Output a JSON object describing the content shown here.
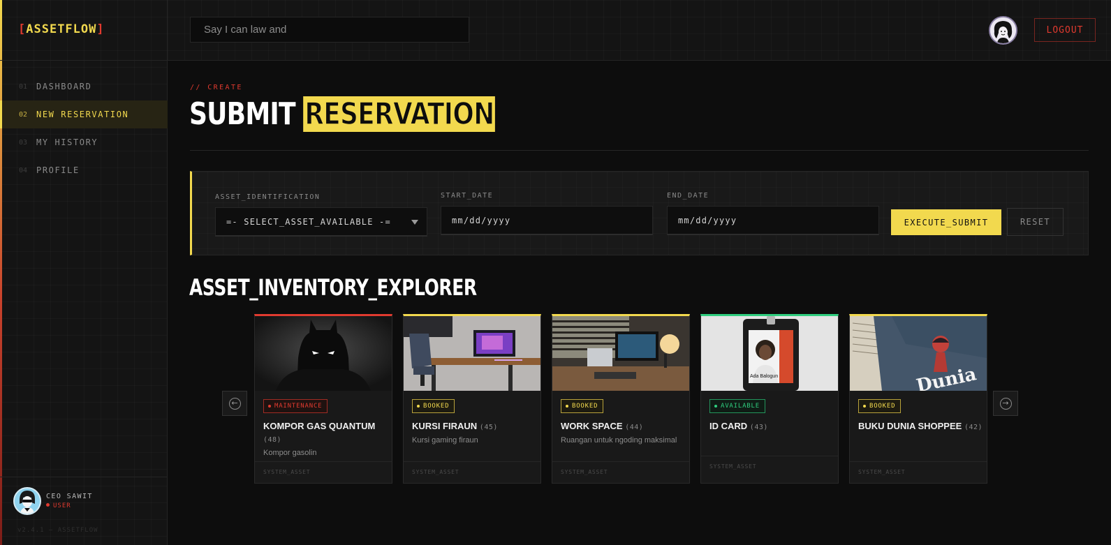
{
  "app": {
    "logo_open": "[",
    "logo_text": "ASSETFLOW",
    "logo_close": "]",
    "version": "v2.4.1 — ASSETFLOW"
  },
  "sidebar": {
    "items": [
      {
        "num": "01",
        "label": "DASHBOARD",
        "active": false
      },
      {
        "num": "02",
        "label": "NEW RESERVATION",
        "active": true
      },
      {
        "num": "03",
        "label": "MY HISTORY",
        "active": false
      },
      {
        "num": "04",
        "label": "PROFILE",
        "active": false
      }
    ],
    "user": {
      "name": "CEO SAWIT",
      "role": "USER"
    }
  },
  "topbar": {
    "search_value": "Say I can law and",
    "logout_label": "LOGOUT"
  },
  "page": {
    "crumb": "// CREATE",
    "title_plain": "SUBMIT",
    "title_outline": "RESERVATION"
  },
  "form": {
    "asset_label": "ASSET_IDENTIFICATION",
    "asset_value": "=- SELECT_ASSET_AVAILABLE -=",
    "start_label": "START_DATE",
    "start_placeholder": "mm/dd/yyyy",
    "end_label": "END_DATE",
    "end_placeholder": "mm/dd/yyyy",
    "submit_label": "EXECUTE_SUBMIT",
    "reset_label": "RESET"
  },
  "inventory": {
    "title": "ASSET_INVENTORY_EXPLORER",
    "prev_icon": "arrow-left-icon",
    "next_icon": "arrow-right-icon",
    "cards": [
      {
        "status": "MAINTENANCE",
        "name": "KOMPOR GAS QUANTUM",
        "count": "(48)",
        "desc": "Kompor gasolin",
        "footer": "SYSTEM_ASSET",
        "image": "dark-hero-photo"
      },
      {
        "status": "BOOKED",
        "name": "KURSI FIRAUN",
        "count": "(45)",
        "desc": "Kursi gaming firaun",
        "footer": "SYSTEM_ASSET",
        "image": "gaming-desk-photo"
      },
      {
        "status": "BOOKED",
        "name": "WORK SPACE",
        "count": "(44)",
        "desc": "Ruangan untuk ngoding maksimal",
        "footer": "SYSTEM_ASSET",
        "image": "workspace-photo"
      },
      {
        "status": "AVAILABLE",
        "name": "ID CARD",
        "count": "(43)",
        "desc": "",
        "footer": "SYSTEM_ASSET",
        "image": "id-card-photo",
        "id_name": "Ada Balogun"
      },
      {
        "status": "BOOKED",
        "name": "BUKU DUNIA SHOPPEE",
        "count": "(42)",
        "desc": "",
        "footer": "SYSTEM_ASSET",
        "image": "book-cover-photo",
        "book_text": "Dunia"
      }
    ]
  },
  "colors": {
    "accent": "#f2d94e",
    "danger": "#e03a2f",
    "success": "#2fce7e",
    "background": "#0d0d0d"
  }
}
